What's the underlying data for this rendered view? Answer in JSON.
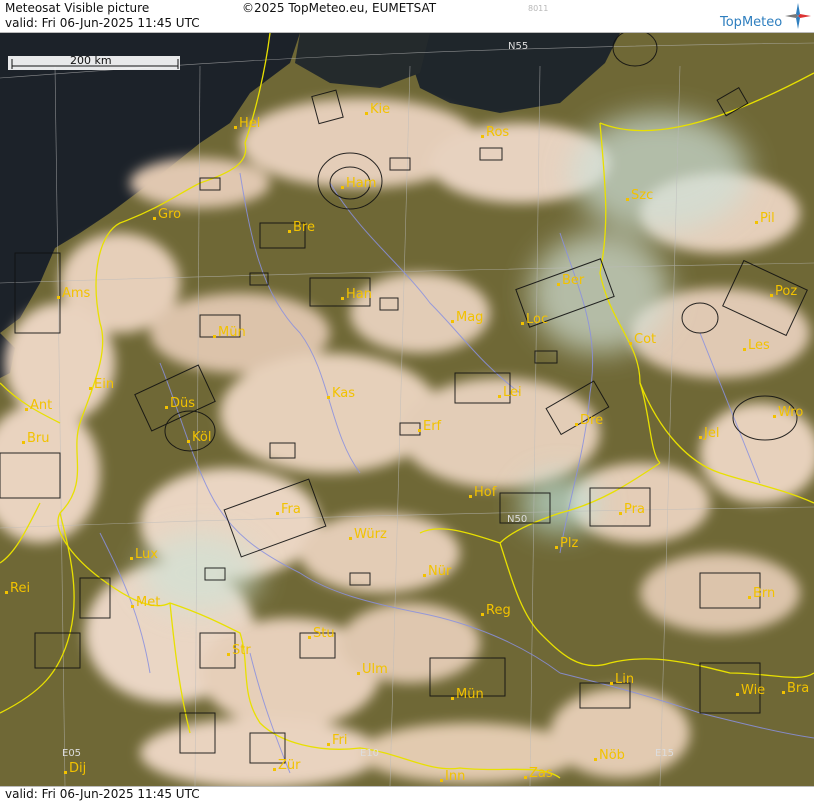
{
  "header": {
    "title": "Meteosat Visible picture",
    "valid_line": "valid:  Fri   06-Jun-2025  11:45 UTC",
    "copyright": "©2025 TopMeteo.eu, EUMETSAT",
    "product_code": "8011",
    "brand": "TopMeteo"
  },
  "footer": {
    "valid_line": "valid:  Fri   06-Jun-2025  11:45 UTC"
  },
  "scale_bar": {
    "label": "200 km"
  },
  "grid_labels": [
    "N55",
    "N50",
    "E05",
    "E10",
    "E15"
  ],
  "cities": [
    "Hel",
    "Kie",
    "Ros",
    "Ham",
    "Szc",
    "Gro",
    "Bre",
    "Pil",
    "Ams",
    "Han",
    "Ber",
    "Poz",
    "Mün",
    "Mag",
    "Loc",
    "Cot",
    "Les",
    "Ein",
    "Kas",
    "Lei",
    "Ant",
    "Düs",
    "Dre",
    "Wro",
    "Bru",
    "Köl",
    "Erf",
    "Jel",
    "Hof",
    "Fra",
    "Pra",
    "Würz",
    "Plz",
    "Lux",
    "Nür",
    "Rei",
    "Met",
    "Reg",
    "Brn",
    "Str",
    "Stu",
    "Ulm",
    "Lin",
    "Mün",
    "Wie",
    "Bra",
    "Fri",
    "Zür",
    "Dij",
    "Inn",
    "Zas",
    "Nöb"
  ],
  "colors": {
    "land": "#6f6836",
    "cloud": "#e9d3bf",
    "sea": "#1c2229",
    "border": "#e8e000",
    "river": "#8a90e0",
    "city": "#f2c200",
    "brand": "#2f7fbf"
  }
}
